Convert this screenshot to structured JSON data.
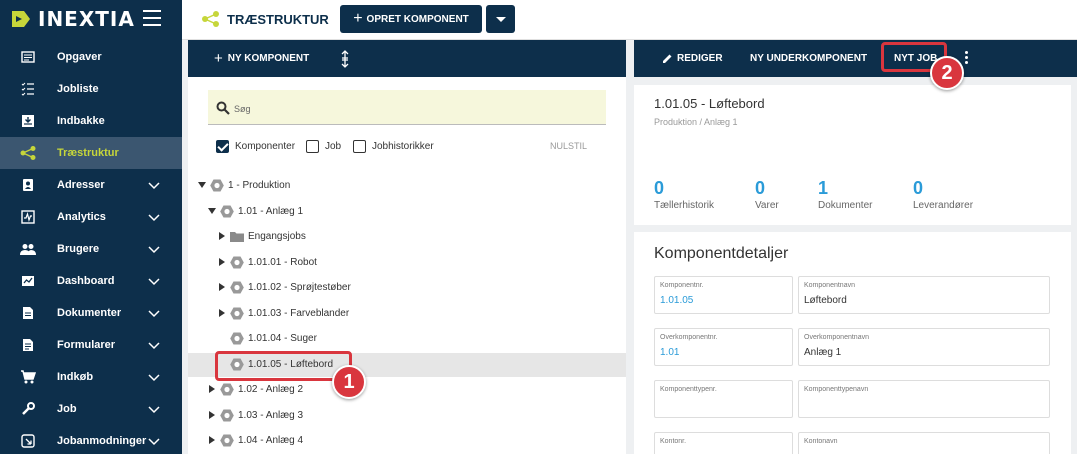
{
  "app": {
    "logo_text": "INEXTIA"
  },
  "sidebar": {
    "items": [
      {
        "label": "Opgaver",
        "icon": "list-icon",
        "active": false,
        "expandable": false
      },
      {
        "label": "Jobliste",
        "icon": "checklist-icon",
        "active": false,
        "expandable": false
      },
      {
        "label": "Indbakke",
        "icon": "inbox-icon",
        "active": false,
        "expandable": false
      },
      {
        "label": "Træstruktur",
        "icon": "tree-icon",
        "active": true,
        "expandable": false
      },
      {
        "label": "Adresser",
        "icon": "address-icon",
        "active": false,
        "expandable": true
      },
      {
        "label": "Analytics",
        "icon": "analytics-icon",
        "active": false,
        "expandable": true
      },
      {
        "label": "Brugere",
        "icon": "users-icon",
        "active": false,
        "expandable": true
      },
      {
        "label": "Dashboard",
        "icon": "dashboard-icon",
        "active": false,
        "expandable": true
      },
      {
        "label": "Dokumenter",
        "icon": "document-icon",
        "active": false,
        "expandable": true
      },
      {
        "label": "Formularer",
        "icon": "form-icon",
        "active": false,
        "expandable": true
      },
      {
        "label": "Indkøb",
        "icon": "cart-icon",
        "active": false,
        "expandable": true
      },
      {
        "label": "Job",
        "icon": "wrench-icon",
        "active": false,
        "expandable": true
      },
      {
        "label": "Jobanmodninger",
        "icon": "request-icon",
        "active": false,
        "expandable": true
      }
    ]
  },
  "topbar": {
    "title": "TRÆSTRUKTUR",
    "create_label": "OPRET KOMPONENT"
  },
  "left": {
    "new_component_label": "NY KOMPONENT",
    "search_placeholder": "Søg",
    "filters": [
      {
        "label": "Komponenter",
        "checked": true
      },
      {
        "label": "Job",
        "checked": false
      },
      {
        "label": "Jobhistorikker",
        "checked": false
      }
    ],
    "reset_label": "NULSTIL",
    "tree": [
      {
        "label": "1 - Produktion",
        "level": 0,
        "expander": "down",
        "icon": "hex",
        "selected": false
      },
      {
        "label": "1.01 - Anlæg 1",
        "level": 1,
        "expander": "down",
        "icon": "hex",
        "selected": false
      },
      {
        "label": "Engangsjobs",
        "level": 2,
        "expander": "right",
        "icon": "folder",
        "selected": false
      },
      {
        "label": "1.01.01 - Robot",
        "level": 2,
        "expander": "right",
        "icon": "hex",
        "selected": false
      },
      {
        "label": "1.01.02 - Sprøjtestøber",
        "level": 2,
        "expander": "right",
        "icon": "hex",
        "selected": false
      },
      {
        "label": "1.01.03 - Farveblander",
        "level": 2,
        "expander": "right",
        "icon": "hex",
        "selected": false
      },
      {
        "label": "1.01.04 - Suger",
        "level": 2,
        "expander": "none",
        "icon": "hex",
        "selected": false
      },
      {
        "label": "1.01.05 - Løftebord",
        "level": 2,
        "expander": "none",
        "icon": "hex",
        "selected": true
      },
      {
        "label": "1.02 - Anlæg 2",
        "level": 1,
        "expander": "right",
        "icon": "hex",
        "selected": false
      },
      {
        "label": "1.03 - Anlæg 3",
        "level": 1,
        "expander": "right",
        "icon": "hex",
        "selected": false
      },
      {
        "label": "1.04 - Anlæg 4",
        "level": 1,
        "expander": "right",
        "icon": "hex",
        "selected": false
      }
    ]
  },
  "right": {
    "toolbar": {
      "edit_label": "REDIGER",
      "sub_label": "NY UNDERKOMPONENT",
      "job_label": "NYT JOB"
    },
    "title": "1.01.05 - Løftebord",
    "path": "Produktion / Anlæg 1",
    "stats": [
      {
        "value": "0",
        "label": "Tællerhistorik"
      },
      {
        "value": "0",
        "label": "Varer"
      },
      {
        "value": "1",
        "label": "Dokumenter"
      },
      {
        "value": "0",
        "label": "Leverandører"
      }
    ],
    "details_title": "Komponentdetaljer",
    "fields": [
      {
        "label": "Komponentnr.",
        "value": "1.01.05",
        "link": true
      },
      {
        "label": "Komponentnavn",
        "value": "Løftebord",
        "link": false
      },
      {
        "label": "Overkomponentnr.",
        "value": "1.01",
        "link": true
      },
      {
        "label": "Overkomponentnavn",
        "value": "Anlæg 1",
        "link": false
      },
      {
        "label": "Komponenttypenr.",
        "value": "",
        "link": false
      },
      {
        "label": "Komponenttypenavn",
        "value": "",
        "link": false
      },
      {
        "label": "Kontonr.",
        "value": "",
        "link": false
      },
      {
        "label": "Kontonavn",
        "value": "",
        "link": false
      }
    ]
  },
  "callouts": {
    "first": "1",
    "second": "2"
  },
  "colors": {
    "navy": "#0d2f4b",
    "accent": "#c6d63a",
    "link": "#2a9bd8",
    "callout": "#d9363e"
  }
}
